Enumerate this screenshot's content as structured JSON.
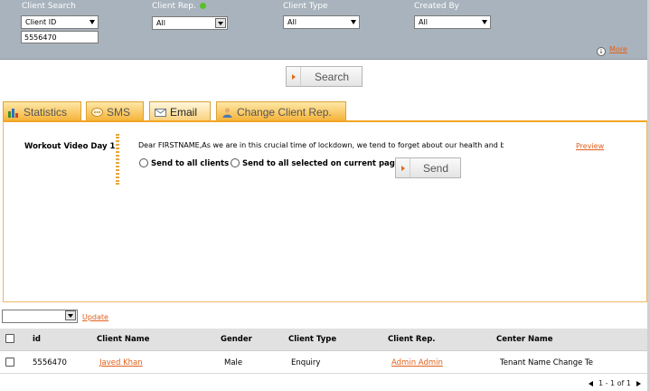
{
  "filters": {
    "client_search": {
      "label": "Client Search",
      "selected": "Client ID",
      "input_value": "5556470"
    },
    "client_rep": {
      "label": "Client Rep.",
      "selected": "All"
    },
    "client_type": {
      "label": "Client Type",
      "selected": "All"
    },
    "created_by": {
      "label": "Created By",
      "selected": "All"
    },
    "more_label": "More"
  },
  "search_button": "Search",
  "tabs": [
    {
      "label": "Statistics",
      "icon": "chart-icon"
    },
    {
      "label": "SMS",
      "icon": "sms-icon"
    },
    {
      "label": "Email",
      "icon": "envelope-icon",
      "active": true
    },
    {
      "label": "Change Client Rep.",
      "icon": "person-icon"
    }
  ],
  "email": {
    "template_name": "Workout Video Day 1",
    "message": "Dear FIRSTNAME,As we are in this crucial time of lockdown, we tend to forget about our health and bi",
    "preview_label": "Preview",
    "option_all": "Send to all clients",
    "option_selected": "Send to all selected on current page",
    "send_label": "Send"
  },
  "bulk": {
    "update_label": "Update"
  },
  "table": {
    "headers": [
      "id",
      "Client Name",
      "Gender",
      "Client Type",
      "Client Rep.",
      "Center Name"
    ],
    "rows": [
      {
        "id": "5556470",
        "client_name": "Javed Khan",
        "gender": "Male",
        "client_type": "Enquiry",
        "client_rep": "Admin Admin",
        "center_name": "Tenant Name Change Te"
      }
    ]
  },
  "pager": {
    "text": "1 - 1 of 1"
  },
  "colors": {
    "filter_bar": "#a8b3bd",
    "tab_orange": "#f6b43b",
    "link": "#e2601c"
  }
}
